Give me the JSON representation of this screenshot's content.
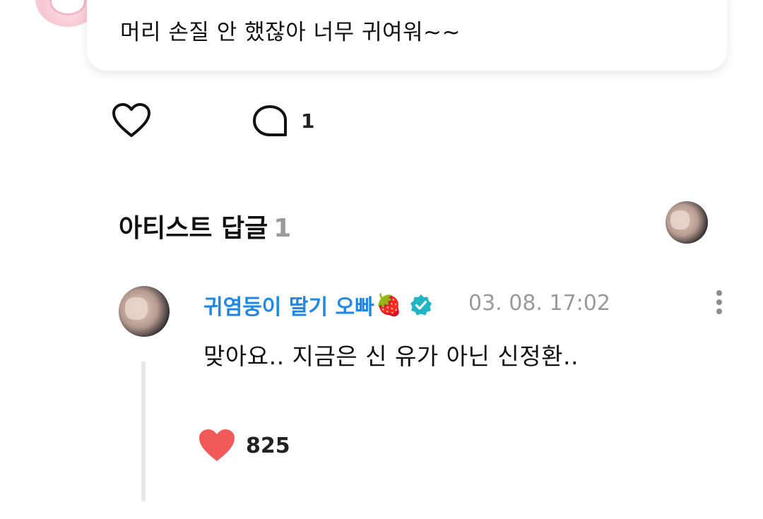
{
  "post": {
    "comment_text": "머리 손질 안 했잖아 너무 귀여워~~",
    "comment_count": "1"
  },
  "artist_replies": {
    "title": "아티스트 답글",
    "count": "1"
  },
  "reply": {
    "author_name": "귀염둥이 딸기 오빠",
    "author_emoji": "🍓",
    "timestamp": "03. 08. 17:02",
    "text": "맞아요.. 지금은 신 유가 아닌 신정환..",
    "like_count": "825"
  },
  "colors": {
    "accent_blue": "#1e88e5",
    "verified_teal": "#1fb5c4",
    "heart_red": "#f25a5a"
  },
  "icons": [
    "heart-outline-icon",
    "comment-bubble-icon",
    "verified-badge-icon",
    "more-vertical-icon",
    "heart-filled-icon"
  ]
}
